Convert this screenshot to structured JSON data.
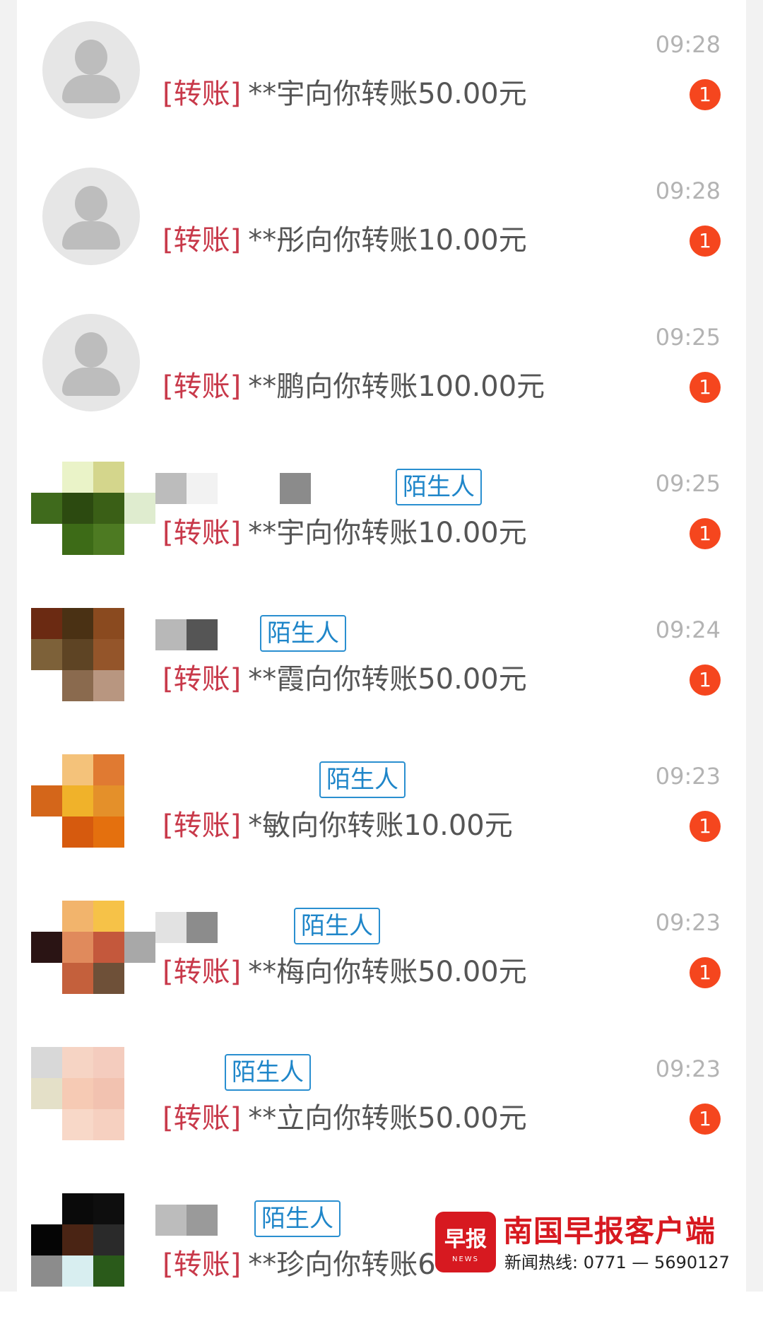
{
  "conversations": [
    {
      "time": "09:28",
      "msg_title": "[转账]",
      "msg_body": "**宇向你转账50.00元",
      "unread": "1"
    },
    {
      "time": "09:28",
      "msg_title": "[转账]",
      "msg_body": "**彤向你转账10.00元",
      "unread": "1"
    },
    {
      "time": "09:25",
      "msg_title": "[转账]",
      "msg_body": "**鹏向你转账100.00元",
      "unread": "1"
    },
    {
      "time": "09:25",
      "tag": "陌生人",
      "msg_title": "[转账]",
      "msg_body": "**宇向你转账10.00元",
      "unread": "1"
    },
    {
      "time": "09:24",
      "tag": "陌生人",
      "msg_title": "[转账]",
      "msg_body": "**霞向你转账50.00元",
      "unread": "1"
    },
    {
      "time": "09:23",
      "tag": "陌生人",
      "msg_title": "[转账]",
      "msg_body": "*敏向你转账10.00元",
      "unread": "1"
    },
    {
      "time": "09:23",
      "tag": "陌生人",
      "msg_title": "[转账]",
      "msg_body": "**梅向你转账50.00元",
      "unread": "1"
    },
    {
      "time": "09:23",
      "tag": "陌生人",
      "msg_title": "[转账]",
      "msg_body": "**立向你转账50.00元",
      "unread": "1"
    },
    {
      "tag": "陌生人",
      "msg_title": "[转账]",
      "msg_body": "**珍向你转账6"
    }
  ],
  "watermark": {
    "logo_text": "早报",
    "logo_sub": "NEWS",
    "name": "南国早报客户端",
    "hotline": "新闻热线: 0771 — 5690127"
  },
  "colors": {
    "transfer_label": "#c8394a",
    "stranger_tag": "#1f86c9",
    "badge": "#f5461e",
    "brand_red": "#d71920"
  }
}
